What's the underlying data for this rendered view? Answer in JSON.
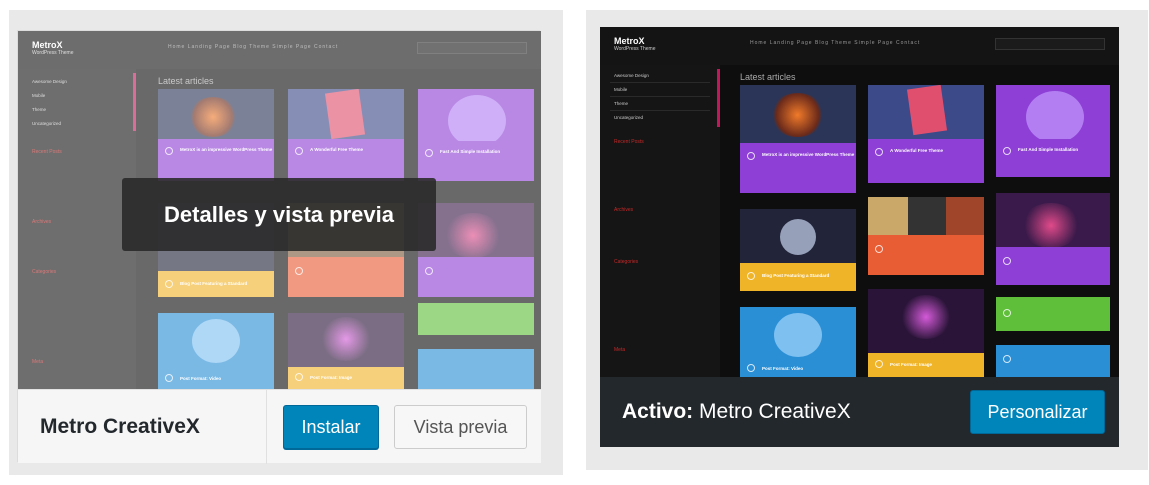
{
  "install_card": {
    "theme_name": "Metro CreativeX",
    "overlay_label": "Detalles y vista previa",
    "install_label": "Instalar",
    "preview_label": "Vista previa"
  },
  "active_card": {
    "active_prefix": "Activo:",
    "theme_name": " Metro CreativeX",
    "customize_label": "Personalizar"
  },
  "theme_preview": {
    "logo": "MetroX",
    "tagline": "WordPress Theme",
    "heading": "Latest articles",
    "nav": "Home   Landing Page   Blog   Theme   Simple Page   Contact",
    "sidebar_items": [
      "Awesome Design",
      "Mobile",
      "Theme",
      "Uncategorized"
    ],
    "sidebar_sections": [
      "Recent Posts",
      "Archives",
      "Categories",
      "Meta"
    ],
    "tile_titles": [
      "MetroX is an impressive WordPress Theme",
      "A Wonderful Free Theme",
      "Fast And Simple Installation",
      "Blog Post Featuring a Standard",
      "Post Format: Video",
      "Post Format: Image"
    ]
  },
  "colors": {
    "wp_blue": "#0085ba",
    "tile_purple": "#8e3fd6",
    "tile_orange": "#e95d35",
    "tile_yellow": "#f0b429",
    "tile_blue": "#2b8fd6",
    "tile_green": "#5fbf3a"
  }
}
